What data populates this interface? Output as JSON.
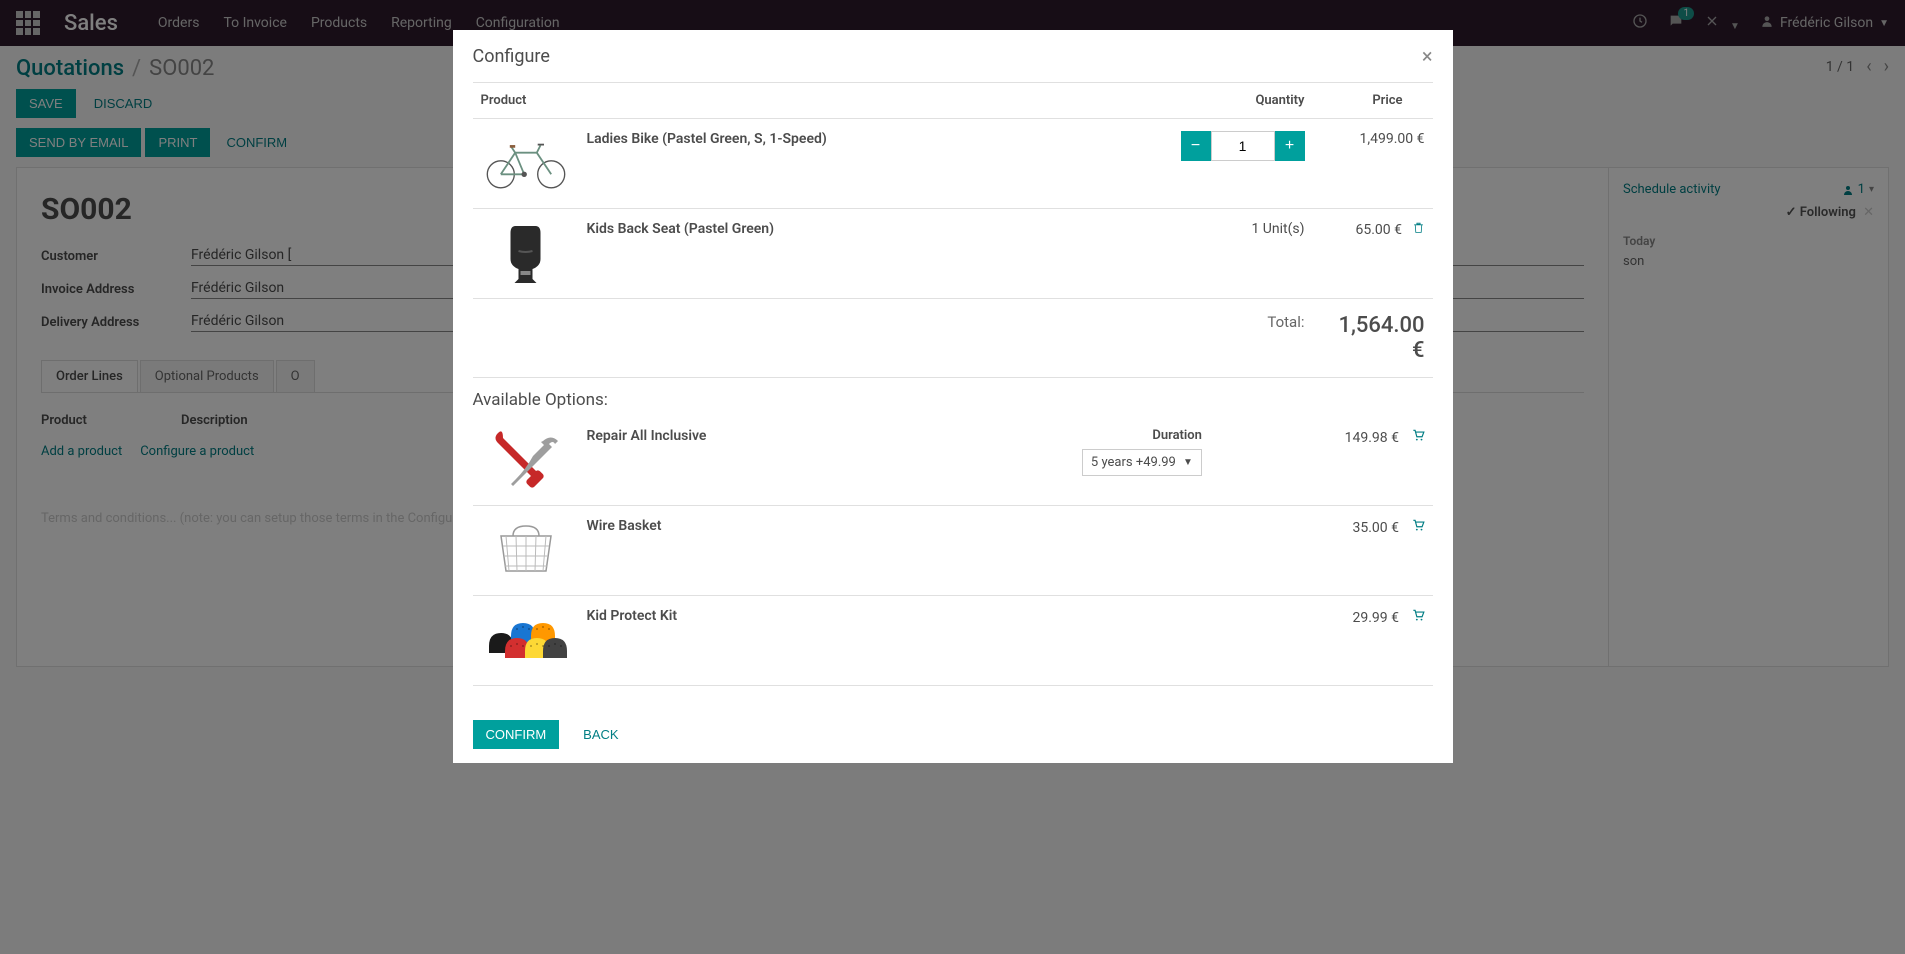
{
  "navbar": {
    "brand": "Sales",
    "menu": [
      "Orders",
      "To Invoice",
      "Products",
      "Reporting",
      "Configuration"
    ],
    "messages_badge": "1",
    "user_name": "Frédéric Gilson"
  },
  "breadcrumb": {
    "root": "Quotations",
    "current": "SO002"
  },
  "toolbar": {
    "save": "SAVE",
    "discard": "DISCARD"
  },
  "pager": {
    "text": "1 / 1"
  },
  "status": {
    "send": "SEND BY EMAIL",
    "print": "PRINT",
    "confirm": "CONFIRM"
  },
  "sheet": {
    "title": "SO002",
    "fields": {
      "customer_label": "Customer",
      "customer_value": "Frédéric Gilson [",
      "invoice_label": "Invoice Address",
      "invoice_value": "Frédéric Gilson",
      "delivery_label": "Delivery Address",
      "delivery_value": "Frédéric Gilson"
    },
    "tabs": [
      "Order Lines",
      "Optional Products",
      "O"
    ],
    "table": {
      "product_header": "Product",
      "description_header": "Description",
      "add_product": "Add a product",
      "configure_product": "Configure a product"
    },
    "terms": "Terms and conditions... (note: you can setup those terms in the Configuration menu)"
  },
  "chatter": {
    "schedule": "Schedule activity",
    "followers_count": "1",
    "following": "Following",
    "today_header": "Today",
    "items": [
      "son"
    ]
  },
  "modal": {
    "title": "Configure",
    "headers": {
      "product": "Product",
      "quantity": "Quantity",
      "price": "Price"
    },
    "lines": [
      {
        "name": "Ladies Bike (Pastel Green, S, 1-Speed)",
        "qty": "1",
        "price": "1,499.00 €",
        "icon": "bike"
      },
      {
        "name": "Kids Back Seat (Pastel Green)",
        "qty_text": "1 Unit(s)",
        "price": "65.00 €",
        "icon": "seat",
        "removable": true
      }
    ],
    "total_label": "Total:",
    "total_value": "1,564.00 €",
    "options_title": "Available Options:",
    "options": [
      {
        "name": "Repair All Inclusive",
        "price": "149.98 €",
        "icon": "repair",
        "attr_label": "Duration",
        "attr_value": "5 years +49.99"
      },
      {
        "name": "Wire Basket",
        "price": "35.00 €",
        "icon": "basket"
      },
      {
        "name": "Kid Protect Kit",
        "price": "29.99 €",
        "icon": "helmets"
      }
    ],
    "confirm": "CONFIRM",
    "back": "BACK"
  }
}
